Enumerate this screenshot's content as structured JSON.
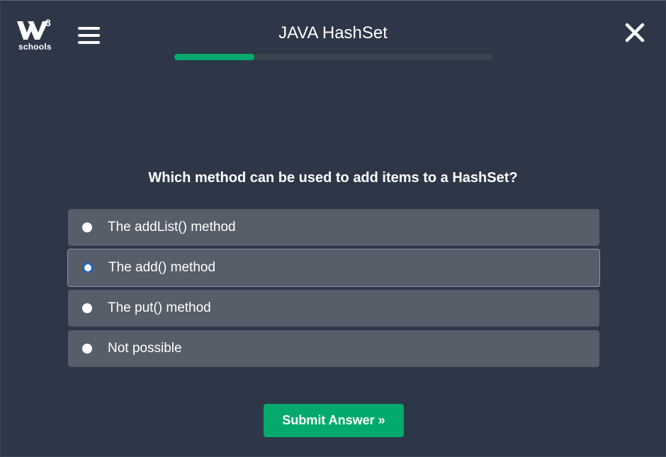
{
  "brand": {
    "logo_sup": "3",
    "logo_word": "schools"
  },
  "header": {
    "title": "JAVA HashSet"
  },
  "progress": {
    "fraction": 0.25,
    "color": "#04aa6d"
  },
  "quiz": {
    "question": "Which method can be used to add items to a HashSet?",
    "options": [
      {
        "label": "The addList() method",
        "selected": false
      },
      {
        "label": "The add() method",
        "selected": true
      },
      {
        "label": "The put() method",
        "selected": false
      },
      {
        "label": "Not possible",
        "selected": false
      }
    ],
    "submit_label": "Submit Answer »"
  },
  "colors": {
    "background": "#2d3748",
    "option_bg": "#555e69",
    "accent": "#04aa6d",
    "radio_selected": "#0a61d8"
  },
  "icons": {
    "menu": "hamburger-menu-icon",
    "close": "close-icon",
    "logo": "w3schools-logo"
  }
}
